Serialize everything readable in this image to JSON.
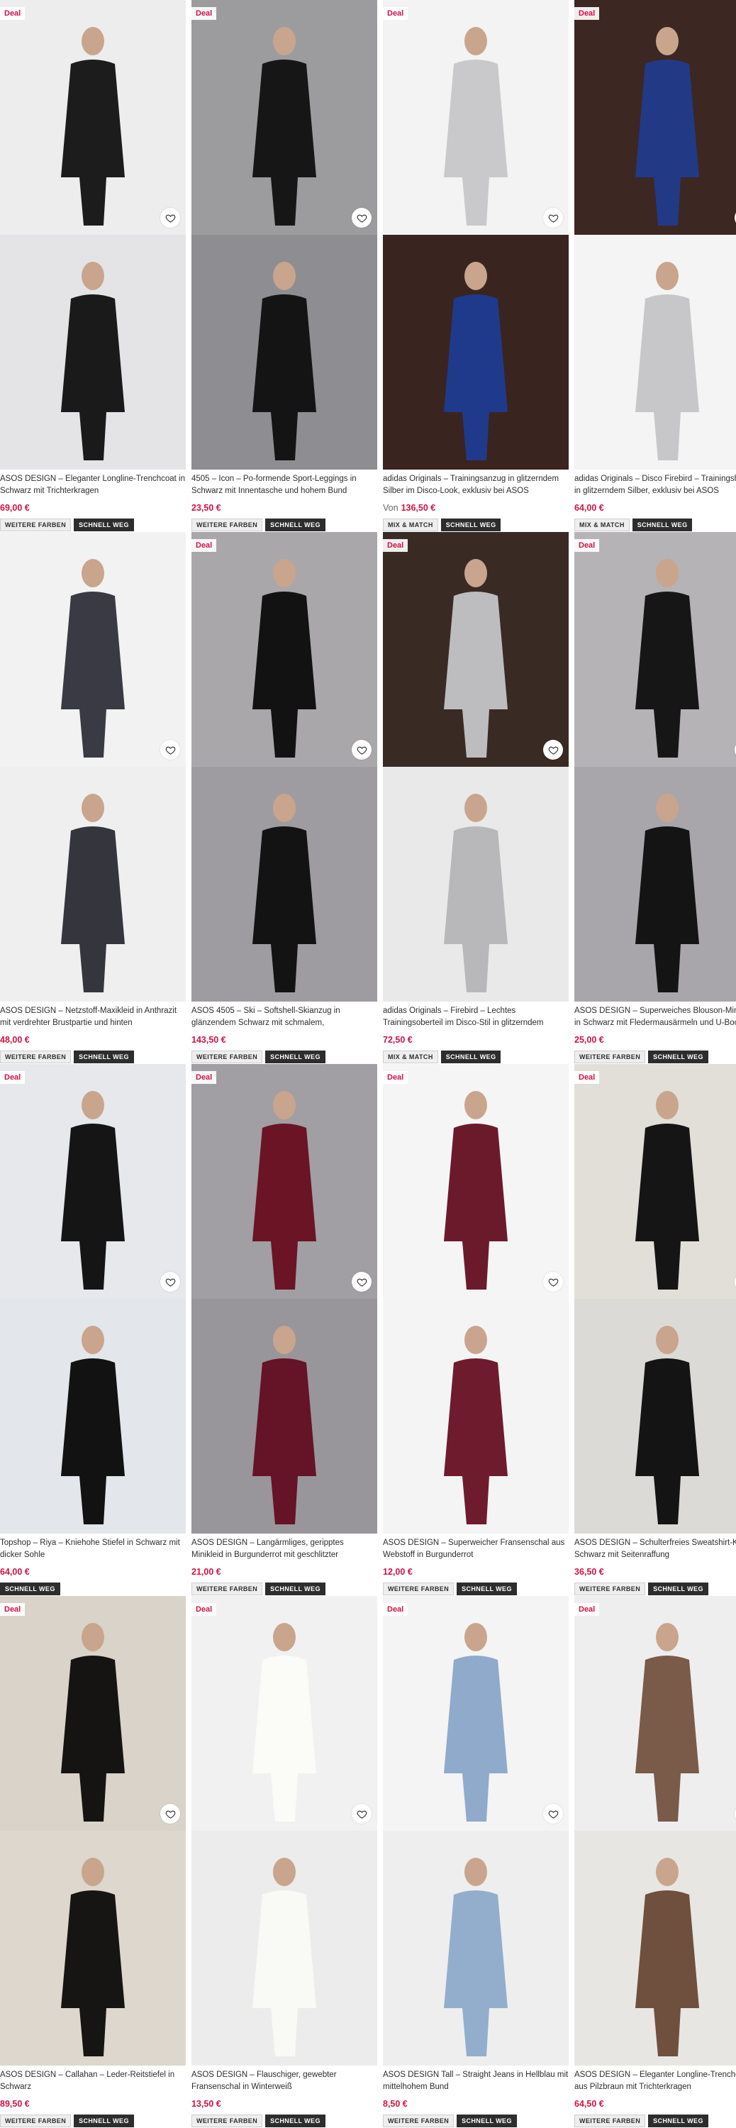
{
  "heart_color": "#2d2d2d",
  "products": [
    {
      "deal": "Deal",
      "title": "ASOS DESIGN – Eleganter Longline-Trenchcoat in Schwarz mit Trichterkragen",
      "price_from": "",
      "price": "69,00 €",
      "badges": [
        "WEITERE FARBEN",
        "SCHNELL WEG"
      ],
      "img1": {
        "bg": "#ededee",
        "fg": "#1c1c1c",
        "icon": "model-coat-icon"
      },
      "img2": {
        "bg": "#e4e4e6",
        "fg": "#1a1a1a",
        "icon": "model-coat-closeup-icon"
      }
    },
    {
      "deal": "Deal",
      "title": "4505 – Icon – Po-formende Sport-Leggings in Schwarz mit Innentasche und hohem Bund",
      "price_from": "",
      "price": "23,50 €",
      "badges": [
        "WEITERE FARBEN",
        "SCHNELL WEG"
      ],
      "img1": {
        "bg": "#9c9c9f",
        "fg": "#161616",
        "icon": "model-leggings-icon"
      },
      "img2": {
        "bg": "#8e8e92",
        "fg": "#141414",
        "icon": "model-leggings-closeup-icon"
      }
    },
    {
      "deal": "Deal",
      "title": "adidas Originals – Trainingsanzug in glitzerndem Silber im Disco-Look, exklusiv bei ASOS",
      "price_from": "Von",
      "price": "136,50 €",
      "badges": [
        "MIX & MATCH",
        "SCHNELL WEG"
      ],
      "img1": {
        "bg": "#f3f3f3",
        "fg": "#c9c9cb",
        "icon": "model-tracksuit-icon"
      },
      "img2": {
        "bg": "#3a2420",
        "fg": "#1f3a8a",
        "icon": "models-party-icon"
      }
    },
    {
      "deal": "Deal",
      "title": "adidas Originals – Disco Firebird – Trainingshose in glitzerndem Silber, exklusiv bei ASOS",
      "price_from": "",
      "price": "64,00 €",
      "badges": [
        "MIX & MATCH",
        "SCHNELL WEG"
      ],
      "img1": {
        "bg": "#3c2722",
        "fg": "#223a85",
        "icon": "models-party-icon"
      },
      "img2": {
        "bg": "#f4f4f4",
        "fg": "#c7c7c9",
        "icon": "model-tracksuit-icon"
      }
    },
    {
      "deal": "",
      "title": "ASOS DESIGN – Netzstoff-Maxikleid in Anthrazit mit verdrehter Brustpartie und hinten gebundenem…",
      "price_from": "",
      "price": "48,00 €",
      "badges": [
        "WEITERE FARBEN",
        "SCHNELL WEG"
      ],
      "img1": {
        "bg": "#f2f2f2",
        "fg": "#3a3a44",
        "icon": "model-maxi-dress-icon"
      },
      "img2": {
        "bg": "#efefef",
        "fg": "#35353e",
        "icon": "model-maxi-dress-back-icon"
      }
    },
    {
      "deal": "Deal",
      "title": "ASOS 4505 – Ski – Softshell-Skianzug in glänzendem Schwarz mit schmalem, ausgestelltem…",
      "price_from": "",
      "price": "143,50 €",
      "badges": [
        "WEITERE FARBEN",
        "SCHNELL WEG"
      ],
      "img1": {
        "bg": "#a9a7aa",
        "fg": "#121212",
        "icon": "model-ski-suit-icon"
      },
      "img2": {
        "bg": "#9e9ca0",
        "fg": "#131313",
        "icon": "model-ski-suit-icon"
      }
    },
    {
      "deal": "Deal",
      "title": "adidas Originals – Firebird – Lechtes Trainingsoberteil im Disco-Stil in glitzerndem Silber…",
      "price_from": "",
      "price": "72,50 €",
      "badges": [
        "MIX & MATCH",
        "SCHNELL WEG"
      ],
      "img1": {
        "bg": "#3a2a24",
        "fg": "#bdbdc0",
        "icon": "model-jacket-icon"
      },
      "img2": {
        "bg": "#e9e9ea",
        "fg": "#b8b8bb",
        "icon": "model-jacket-portrait-icon"
      }
    },
    {
      "deal": "Deal",
      "title": "ASOS DESIGN – Superweiches Blouson-Minikleid in Schwarz mit Fledermausärmeln und U-Boot-…",
      "price_from": "",
      "price": "25,00 €",
      "badges": [
        "WEITERE FARBEN",
        "SCHNELL WEG"
      ],
      "img1": {
        "bg": "#b5b3b6",
        "fg": "#161616",
        "icon": "model-mini-dress-icon"
      },
      "img2": {
        "bg": "#a8a6aa",
        "fg": "#141414",
        "icon": "model-mini-dress-icon"
      }
    },
    {
      "deal": "Deal",
      "title": "Topshop – Riya – Kniehohe Stiefel in Schwarz mit dicker Sohle",
      "price_from": "",
      "price": "64,00 €",
      "badges": [
        "SCHNELL WEG"
      ],
      "img1": {
        "bg": "#e6e8ec",
        "fg": "#151515",
        "icon": "boot-icon"
      },
      "img2": {
        "bg": "#e3e6ea",
        "fg": "#121212",
        "icon": "boots-pair-icon"
      }
    },
    {
      "deal": "Deal",
      "title": "ASOS DESIGN – Langärmliges, geripptes Minikleid in Burgunderrot mit geschlitzter Vorderseite",
      "price_from": "",
      "price": "21,00 €",
      "badges": [
        "WEITERE FARBEN",
        "SCHNELL WEG"
      ],
      "img1": {
        "bg": "#a19fa3",
        "fg": "#6a1426",
        "icon": "model-rib-dress-icon"
      },
      "img2": {
        "bg": "#98969a",
        "fg": "#651326",
        "icon": "model-rib-dress-icon"
      }
    },
    {
      "deal": "Deal",
      "title": "ASOS DESIGN – Superweicher Fransenschal aus Webstoff in Burgunderrot",
      "price_from": "",
      "price": "12,00 €",
      "badges": [
        "WEITERE FARBEN",
        "SCHNELL WEG"
      ],
      "img1": {
        "bg": "#f5f5f5",
        "fg": "#6b1a2c",
        "icon": "model-scarf-icon"
      },
      "img2": {
        "bg": "#f4f4f4",
        "fg": "#6e1b2e",
        "icon": "scarf-icon"
      }
    },
    {
      "deal": "Deal",
      "title": "ASOS DESIGN – Schulterfreies Sweatshirt-Kleid in Schwarz mit Seitenraffung",
      "price_from": "",
      "price": "36,50 €",
      "badges": [
        "WEITERE FARBEN",
        "SCHNELL WEG"
      ],
      "img1": {
        "bg": "#e2dfd9",
        "fg": "#151515",
        "icon": "model-offshoulder-dress-icon"
      },
      "img2": {
        "bg": "#dcdad6",
        "fg": "#141414",
        "icon": "model-offshoulder-dress-icon"
      }
    },
    {
      "deal": "Deal",
      "title": "ASOS DESIGN – Callahan – Leder-Reitstiefel in Schwarz",
      "price_from": "",
      "price": "89,50 €",
      "badges": [
        "WEITERE FARBEN",
        "SCHNELL WEG"
      ],
      "img1": {
        "bg": "#d9d3c9",
        "fg": "#161412",
        "icon": "legs-boots-icon"
      },
      "img2": {
        "bg": "#ddd7cd",
        "fg": "#171513",
        "icon": "model-boots-skirt-icon"
      }
    },
    {
      "deal": "Deal",
      "title": "ASOS DESIGN – Flauschiger, gewebter Fransenschal in Winterweiß",
      "price_from": "",
      "price": "13,50 €",
      "badges": [
        "WEITERE FARBEN",
        "SCHNELL WEG"
      ],
      "img1": {
        "bg": "#f1f1f1",
        "fg": "#fbfbf8",
        "icon": "white-scarf-icon"
      },
      "img2": {
        "bg": "#ececec",
        "fg": "#f9f9f6",
        "icon": "white-scarf-closeup-icon"
      }
    },
    {
      "deal": "Deal",
      "title": "ASOS DESIGN Tall – Straight Jeans in Hellblau mit mittelhohem Bund",
      "price_from": "",
      "price": "8,50 €",
      "badges": [
        "WEITERE FARBEN",
        "SCHNELL WEG"
      ],
      "img1": {
        "bg": "#f4f4f4",
        "fg": "#8faacb",
        "icon": "model-jeans-icon"
      },
      "img2": {
        "bg": "#eeeeee",
        "fg": "#93aecd",
        "icon": "jeans-closeup-icon"
      }
    },
    {
      "deal": "Deal",
      "title": "ASOS DESIGN – Eleganter Longline-Trenchcoat aus Pilzbraun mit Trichterkragen",
      "price_from": "",
      "price": "64,50 €",
      "badges": [
        "WEITERE FARBEN",
        "SCHNELL WEG"
      ],
      "img1": {
        "bg": "#eeeeee",
        "fg": "#7a5a48",
        "icon": "model-brown-coat-icon"
      },
      "img2": {
        "bg": "#e8e6e3",
        "fg": "#6f4f3e",
        "icon": "model-brown-coat-portrait-icon"
      }
    }
  ]
}
